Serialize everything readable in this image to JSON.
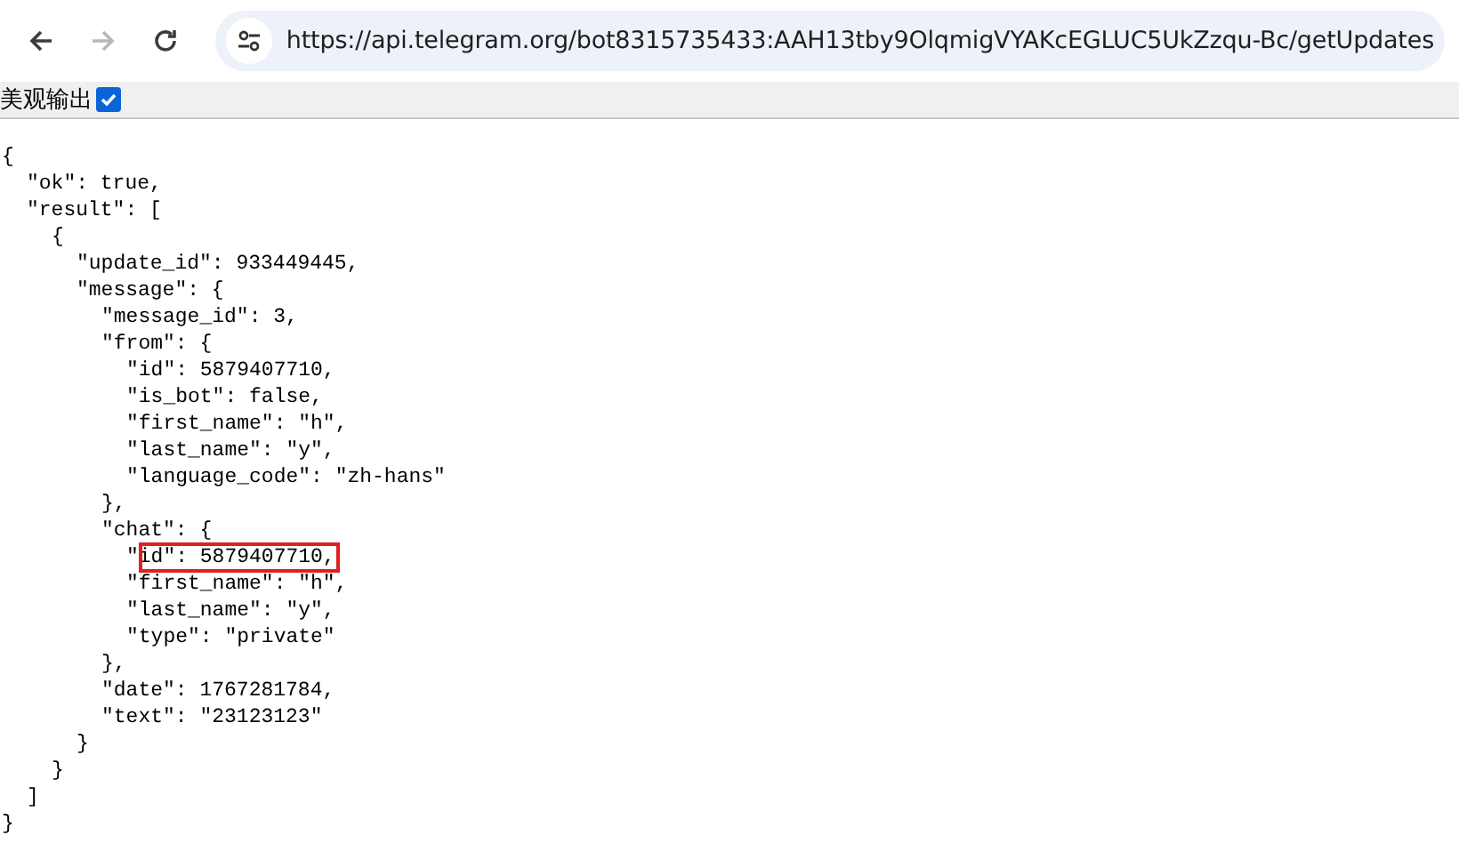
{
  "browser": {
    "url": "https://api.telegram.org/bot8315735433:AAH13tby9OlqmigVYAKcEGLUC5UkZzqu-Bc/getUpdates",
    "back_disabled": false,
    "forward_disabled": true
  },
  "options_bar": {
    "label": "美观输出",
    "checked": true
  },
  "json": {
    "open": "{",
    "close": "}",
    "children": [
      {
        "text": "\"ok\": true,"
      },
      {
        "open": "\"result\": [",
        "close": "]",
        "children": [
          {
            "open": "{",
            "close": "}",
            "children": [
              {
                "text": "\"update_id\": 933449445,"
              },
              {
                "open": "\"message\": {",
                "close": "}",
                "children": [
                  {
                    "text": "\"message_id\": 3,"
                  },
                  {
                    "open": "\"from\": {",
                    "close": "},",
                    "children": [
                      {
                        "text": "\"id\": 5879407710,"
                      },
                      {
                        "text": "\"is_bot\": false,"
                      },
                      {
                        "text": "\"first_name\": \"h\","
                      },
                      {
                        "text": "\"last_name\": \"y\","
                      },
                      {
                        "text": "\"language_code\": \"zh-hans\""
                      }
                    ]
                  },
                  {
                    "open": "\"chat\": {",
                    "close": "},",
                    "children": [
                      {
                        "text": "\"id\": 5879407710,",
                        "highlighted": true
                      },
                      {
                        "text": "\"first_name\": \"h\","
                      },
                      {
                        "text": "\"last_name\": \"y\","
                      },
                      {
                        "text": "\"type\": \"private\""
                      }
                    ]
                  },
                  {
                    "text": "\"date\": 1767281784,"
                  },
                  {
                    "text": "\"text\": \"23123123\""
                  }
                ]
              }
            ]
          }
        ]
      }
    ]
  }
}
